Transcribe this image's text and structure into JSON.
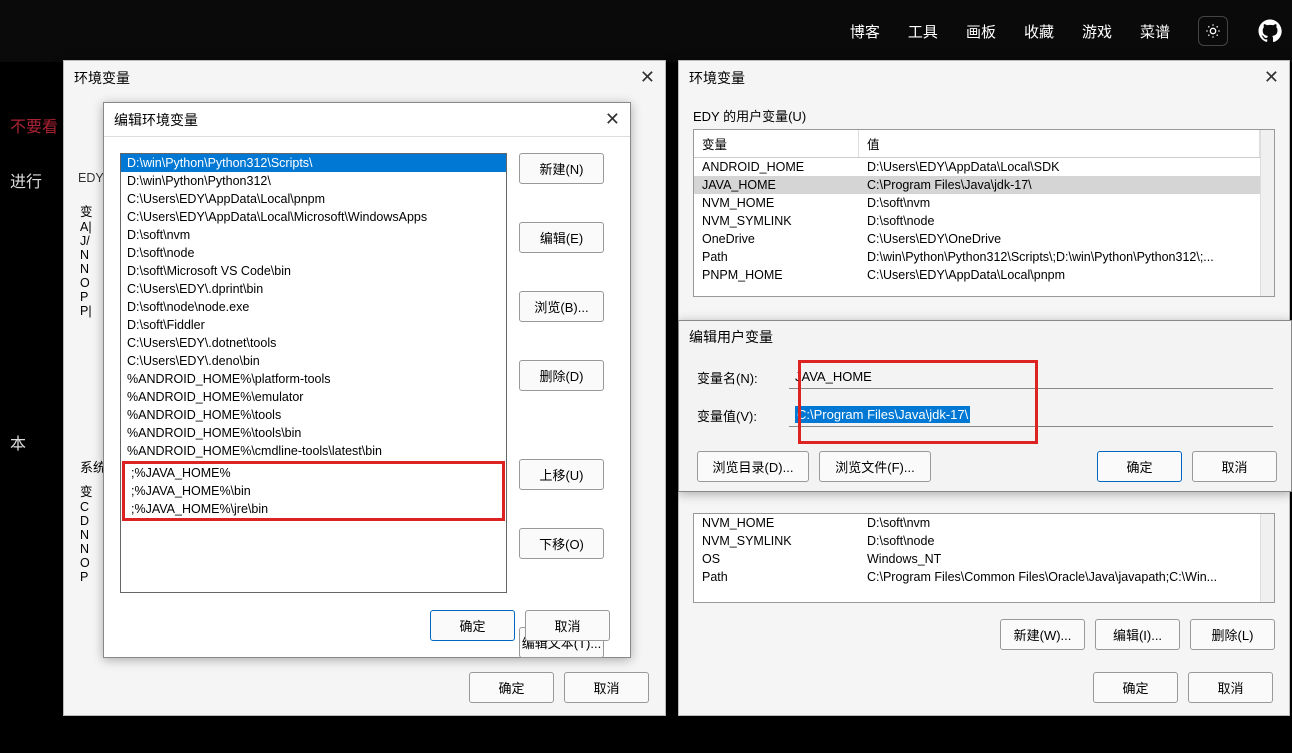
{
  "nav": {
    "items": [
      "博客",
      "工具",
      "画板",
      "收藏",
      "游戏",
      "菜谱"
    ]
  },
  "side": {
    "t1": "不要看",
    "t2": "进行",
    "t3": "本"
  },
  "envLeft": {
    "title": "环境变量",
    "userLabel": "EDY",
    "sysLabel": "系统",
    "peek": [
      "变",
      "A|",
      "J/",
      "N",
      "N",
      "O",
      "P",
      "P|"
    ],
    "sysPeek": [
      "变",
      "C",
      "D",
      "N",
      "N",
      "O",
      "P"
    ],
    "okBtn": "确定",
    "cancelBtn": "取消"
  },
  "editPath": {
    "title": "编辑环境变量",
    "items": [
      "D:\\win\\Python\\Python312\\Scripts\\",
      "D:\\win\\Python\\Python312\\",
      "C:\\Users\\EDY\\AppData\\Local\\pnpm",
      "C:\\Users\\EDY\\AppData\\Local\\Microsoft\\WindowsApps",
      "D:\\soft\\nvm",
      "D:\\soft\\node",
      "D:\\soft\\Microsoft VS Code\\bin",
      "C:\\Users\\EDY\\.dprint\\bin",
      "D:\\soft\\node\\node.exe",
      "D:\\soft\\Fiddler",
      "C:\\Users\\EDY\\.dotnet\\tools",
      "C:\\Users\\EDY\\.deno\\bin",
      "%ANDROID_HOME%\\platform-tools",
      "%ANDROID_HOME%\\emulator",
      "%ANDROID_HOME%\\tools",
      "%ANDROID_HOME%\\tools\\bin",
      "%ANDROID_HOME%\\cmdline-tools\\latest\\bin"
    ],
    "redItems": [
      ";%JAVA_HOME%",
      ";%JAVA_HOME%\\bin",
      ";%JAVA_HOME%\\jre\\bin"
    ],
    "btns": {
      "new": "新建(N)",
      "edit": "编辑(E)",
      "browse": "浏览(B)...",
      "delete": "删除(D)",
      "up": "上移(U)",
      "down": "下移(O)",
      "editText": "编辑文本(T)..."
    },
    "ok": "确定",
    "cancel": "取消"
  },
  "envRight": {
    "title": "环境变量",
    "userLabel": "EDY 的用户变量(U)",
    "hdr1": "变量",
    "hdr2": "值",
    "userVars": [
      {
        "k": "ANDROID_HOME",
        "v": "D:\\Users\\EDY\\AppData\\Local\\SDK"
      },
      {
        "k": "JAVA_HOME",
        "v": "C:\\Program Files\\Java\\jdk-17\\",
        "sel": true
      },
      {
        "k": "NVM_HOME",
        "v": "D:\\soft\\nvm"
      },
      {
        "k": "NVM_SYMLINK",
        "v": "D:\\soft\\node"
      },
      {
        "k": "OneDrive",
        "v": "C:\\Users\\EDY\\OneDrive"
      },
      {
        "k": "Path",
        "v": "D:\\win\\Python\\Python312\\Scripts\\;D:\\win\\Python\\Python312\\;..."
      },
      {
        "k": "PNPM_HOME",
        "v": "C:\\Users\\EDY\\AppData\\Local\\pnpm"
      }
    ],
    "sysVars": [
      {
        "k": "NVM_HOME",
        "v": "D:\\soft\\nvm"
      },
      {
        "k": "NVM_SYMLINK",
        "v": "D:\\soft\\node"
      },
      {
        "k": "OS",
        "v": "Windows_NT"
      },
      {
        "k": "Path",
        "v": "C:\\Program Files\\Common Files\\Oracle\\Java\\javapath;C:\\Win..."
      }
    ],
    "newBtn": "新建(W)...",
    "editBtn": "编辑(I)...",
    "delBtn": "删除(L)",
    "ok": "确定",
    "cancel": "取消"
  },
  "editVar": {
    "title": "编辑用户变量",
    "nameLabel": "变量名(N):",
    "valueLabel": "变量值(V):",
    "name": "JAVA_HOME",
    "value": "C:\\Program Files\\Java\\jdk-17\\",
    "browseDir": "浏览目录(D)...",
    "browseFile": "浏览文件(F)...",
    "ok": "确定",
    "cancel": "取消"
  }
}
